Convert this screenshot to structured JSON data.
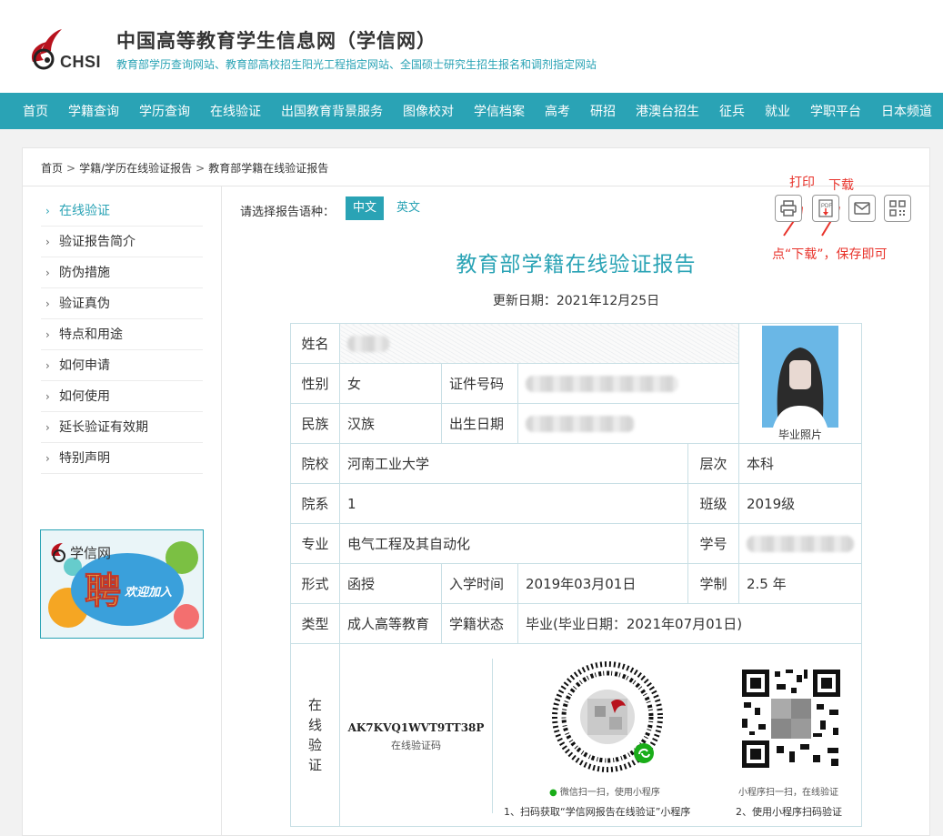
{
  "header": {
    "logo_text": "CHSI",
    "title": "中国高等教育学生信息网（学信网）",
    "subtitle": "教育部学历查询网站、教育部高校招生阳光工程指定网站、全国硕士研究生招生报名和调剂指定网站"
  },
  "nav": [
    "首页",
    "学籍查询",
    "学历查询",
    "在线验证",
    "出国教育背景服务",
    "图像校对",
    "学信档案",
    "高考",
    "研招",
    "港澳台招生",
    "征兵",
    "就业",
    "学职平台",
    "日本频道"
  ],
  "breadcrumb": {
    "items": [
      "首页",
      "学籍/学历在线验证报告",
      "教育部学籍在线验证报告"
    ],
    "sep": ">"
  },
  "sidebar": {
    "items": [
      "在线验证",
      "验证报告简介",
      "防伪措施",
      "验证真伪",
      "特点和用途",
      "如何申请",
      "如何使用",
      "延长验证有效期",
      "特别声明"
    ],
    "ad_text1": "学信网",
    "ad_text2": "聘",
    "ad_text3": "欢迎加入"
  },
  "toolbar": {
    "lang_label": "请选择报告语种：",
    "lang_zh": "中文",
    "lang_en": "英文",
    "print_icon": "printer-icon",
    "pdf_icon": "pdf-download-icon",
    "mail_icon": "mail-icon",
    "qr_icon": "qrcode-icon",
    "pdf_badge": "PDF"
  },
  "annotations": {
    "print": "打印",
    "download": "下载",
    "hint": "点“下载”，保存即可"
  },
  "report": {
    "title": "教育部学籍在线验证报告",
    "update_date": "更新日期：2021年12月25日",
    "labels": {
      "name": "姓名",
      "gender": "性别",
      "id_no": "证件号码",
      "ethnic": "民族",
      "birth": "出生日期",
      "school": "院校",
      "level": "层次",
      "dept": "院系",
      "class": "班级",
      "major": "专业",
      "student_no": "学号",
      "form": "形式",
      "enroll": "入学时间",
      "duration": "学制",
      "type": "类型",
      "status": "学籍状态",
      "verify": "在线验证"
    },
    "values": {
      "gender": "女",
      "ethnic": "汉族",
      "school": "河南工业大学",
      "level": "本科",
      "dept": "1",
      "class": "2019级",
      "major": "电气工程及其自动化",
      "form": "函授",
      "enroll": "2019年03月01日",
      "duration": "2.5 年",
      "type": "成人高等教育",
      "status": "毕业(毕业日期：2021年07月01日)"
    },
    "photo_caption": "毕业照片",
    "verify_code": "AK7KVQ1WVT9TT38P",
    "verify_code_caption": "在线验证码",
    "miniapp_caption": "微信扫一扫，使用小程序",
    "qr_caption": "小程序扫一扫，在线验证",
    "step1": "1、扫码获取“学信网报告在线验证”小程序",
    "step2": "2、使用小程序扫码验证"
  },
  "colors": {
    "accent": "#2aa3b5",
    "annotation": "#e8332b"
  }
}
